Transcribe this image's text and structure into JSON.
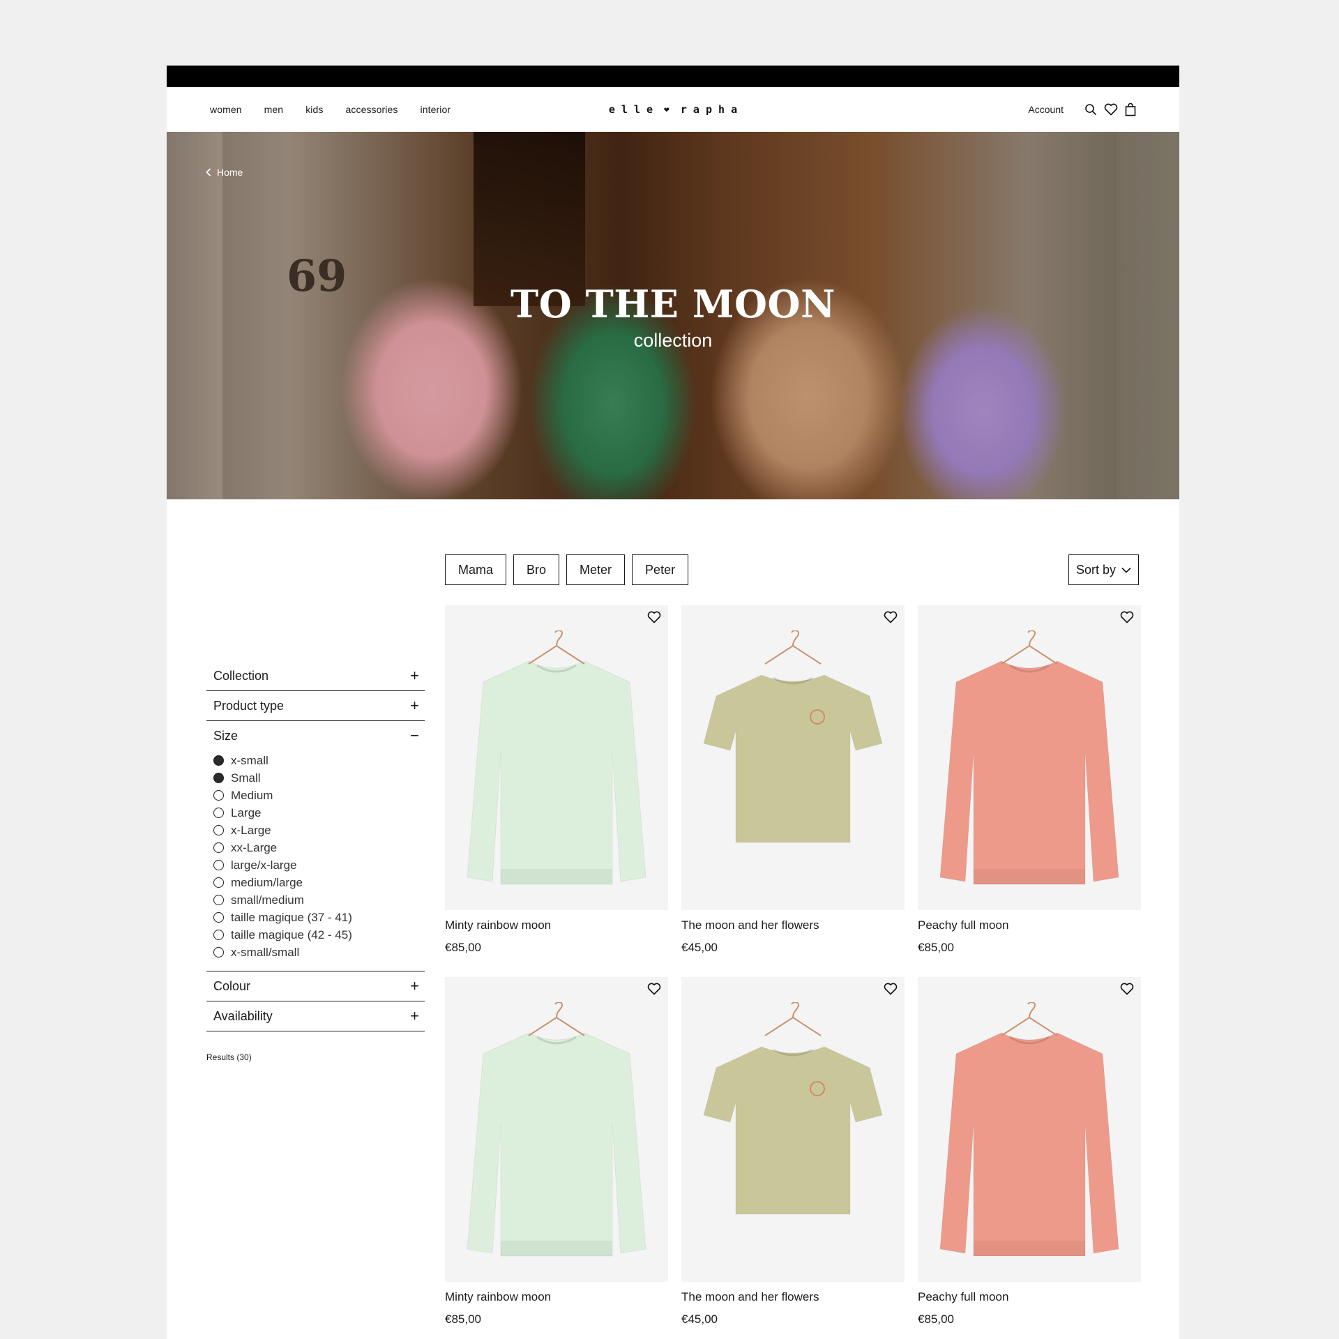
{
  "header": {
    "nav": [
      "women",
      "men",
      "kids",
      "accessories",
      "interior"
    ],
    "logo_left": "e l l e",
    "logo_right": "r a p h a",
    "account": "Account"
  },
  "hero": {
    "back_label": "Home",
    "house_number": "69",
    "title": "TO THE MOON",
    "subtitle": "collection"
  },
  "chips": [
    "Mama",
    "Bro",
    "Meter",
    "Peter"
  ],
  "sort_label": "Sort by",
  "filters": {
    "collection": "Collection",
    "product_type": "Product type",
    "size": "Size",
    "size_options": [
      {
        "label": "x-small",
        "checked": true
      },
      {
        "label": "Small",
        "checked": true
      },
      {
        "label": "Medium",
        "checked": false
      },
      {
        "label": "Large",
        "checked": false
      },
      {
        "label": "x-Large",
        "checked": false
      },
      {
        "label": "xx-Large",
        "checked": false
      },
      {
        "label": "large/x-large",
        "checked": false
      },
      {
        "label": "medium/large",
        "checked": false
      },
      {
        "label": "small/medium",
        "checked": false
      },
      {
        "label": "taille magique (37 - 41)",
        "checked": false
      },
      {
        "label": "taille magique (42 - 45)",
        "checked": false
      },
      {
        "label": "x-small/small",
        "checked": false
      }
    ],
    "colour": "Colour",
    "availability": "Availability"
  },
  "results": "Results (30)",
  "products": [
    {
      "name": "Minty rainbow moon",
      "price": "€85,00",
      "color": "#dcefdc",
      "kind": "sweater"
    },
    {
      "name": "The moon and her flowers",
      "price": "€45,00",
      "color": "#c9c79a",
      "kind": "tee"
    },
    {
      "name": "Peachy full moon",
      "price": "€85,00",
      "color": "#ee9a8a",
      "kind": "sweater"
    },
    {
      "name": "Minty rainbow moon",
      "price": "€85,00",
      "color": "#dcefdc",
      "kind": "sweater"
    },
    {
      "name": "The moon and her flowers",
      "price": "€45,00",
      "color": "#c9c79a",
      "kind": "tee"
    },
    {
      "name": "Peachy full moon",
      "price": "€85,00",
      "color": "#ee9a8a",
      "kind": "sweater"
    }
  ]
}
